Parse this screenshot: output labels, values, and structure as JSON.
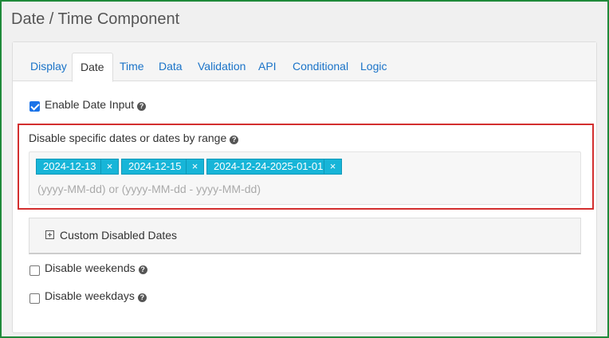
{
  "page": {
    "title": "Date / Time Component"
  },
  "tabs": [
    {
      "label": "Display",
      "active": false
    },
    {
      "label": "Date",
      "active": true
    },
    {
      "label": "Time",
      "active": false
    },
    {
      "label": "Data",
      "active": false
    },
    {
      "label": "Validation",
      "active": false
    },
    {
      "label": "API",
      "active": false
    },
    {
      "label": "Conditional",
      "active": false
    },
    {
      "label": "Logic",
      "active": false
    }
  ],
  "enable_date_input": {
    "label": "Enable Date Input",
    "checked": true
  },
  "disable_dates": {
    "label": "Disable specific dates or dates by range",
    "tags": [
      "2024-12-13",
      "2024-12-15",
      "2024-12-24-2025-01-01"
    ],
    "remove_symbol": "×",
    "placeholder": "(yyyy-MM-dd) or (yyyy-MM-dd - yyyy-MM-dd)"
  },
  "custom_disabled_dates": {
    "label": "Custom Disabled Dates"
  },
  "disable_weekends": {
    "label": "Disable weekends",
    "checked": false
  },
  "disable_weekdays": {
    "label": "Disable weekdays",
    "checked": false
  },
  "help_symbol": "?",
  "colors": {
    "accent": "#1a73c8",
    "tag": "#17b5d8",
    "highlight": "#d32f2f",
    "frame": "#1f8a3a"
  }
}
